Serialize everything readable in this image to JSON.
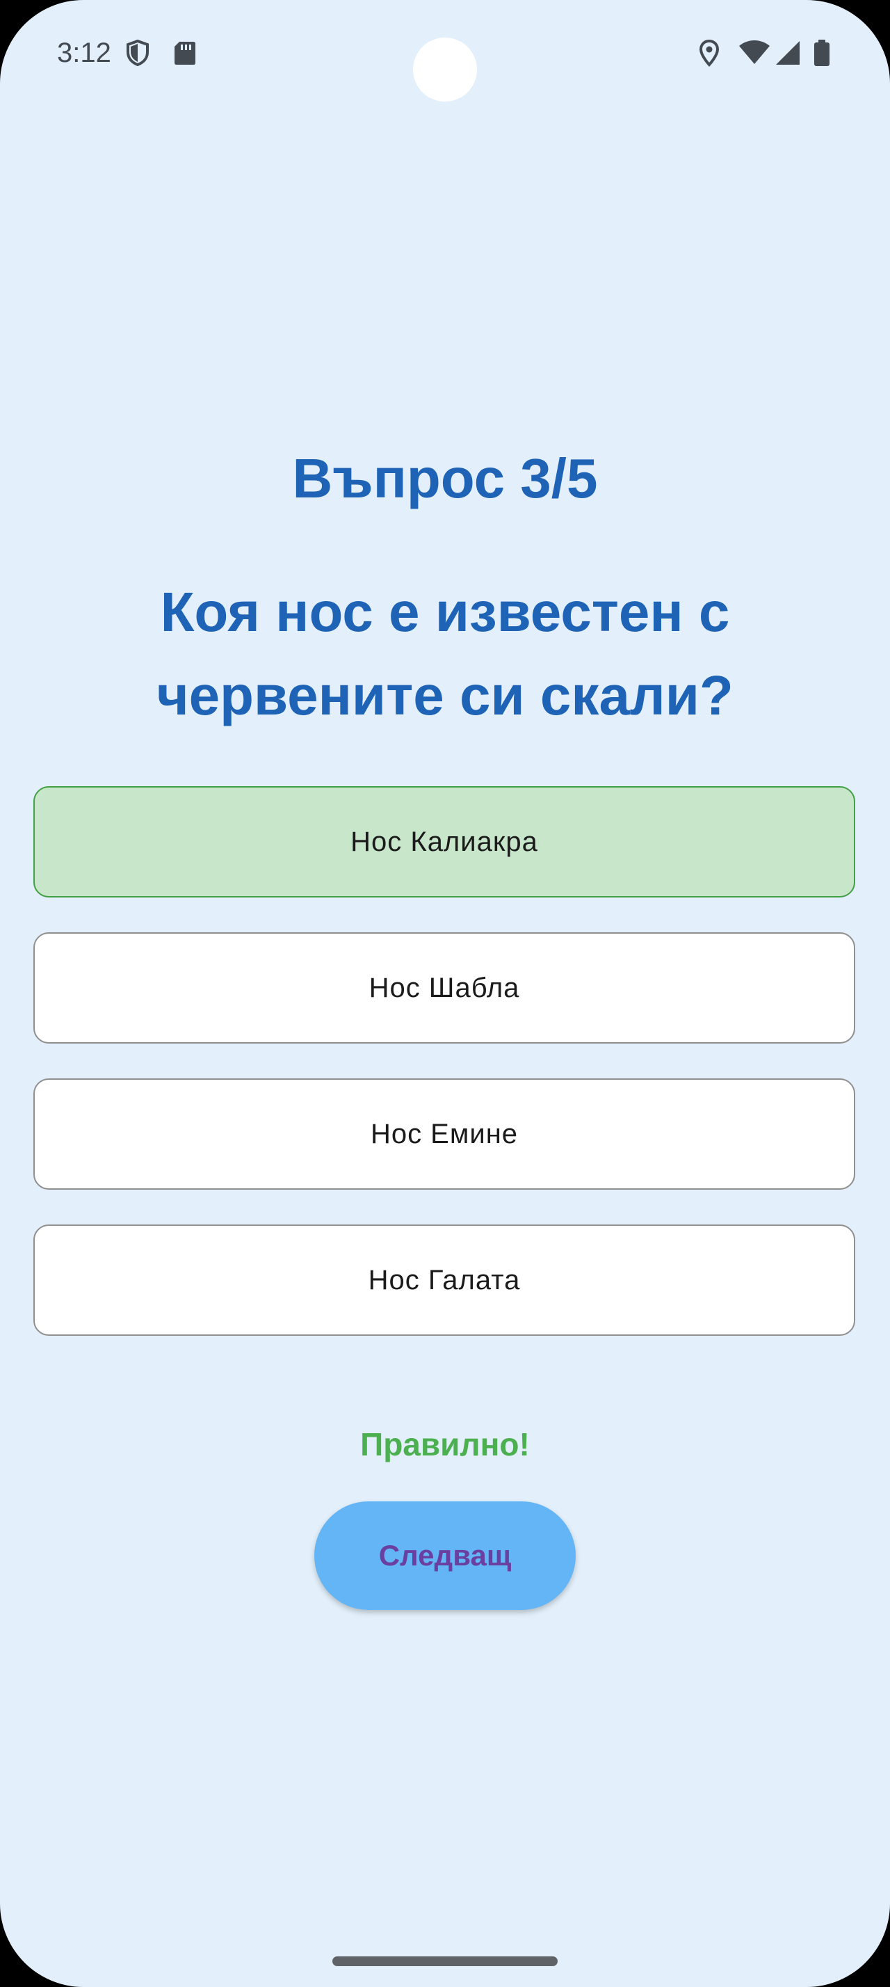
{
  "status_bar": {
    "time": "3:12",
    "icons": [
      "shield-icon",
      "sd-card-icon",
      "location-icon",
      "wifi-icon",
      "signal-icon",
      "battery-icon"
    ]
  },
  "quiz": {
    "counter": "Въпрос 3/5",
    "question": "Коя нос е известен с червените си скали?",
    "answers": [
      {
        "label": "Нос Калиакра",
        "state": "correct"
      },
      {
        "label": "Нос Шабла",
        "state": "default"
      },
      {
        "label": "Нос Емине",
        "state": "default"
      },
      {
        "label": "Нос Галата",
        "state": "default"
      }
    ],
    "feedback": "Правилно!",
    "next_label": "Следващ"
  },
  "colors": {
    "background": "#e3f0fb",
    "title": "#1e63b5",
    "correct_fill": "#c8e6c9",
    "correct_border": "#43a047",
    "feedback": "#4caf50",
    "button": "#64b5f6",
    "button_text": "#6a3fa0"
  }
}
